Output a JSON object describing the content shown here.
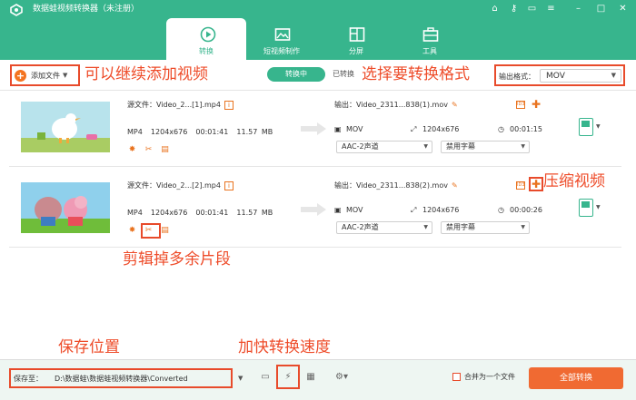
{
  "app": {
    "title": "数据蛙视频转换器（未注册）"
  },
  "window_controls": [
    "cart-icon",
    "key-icon",
    "chat-icon",
    "menu-icon",
    "minimize-icon",
    "maximize-icon",
    "close-icon"
  ],
  "tabs": [
    {
      "label": "转换",
      "icon": "convert-icon",
      "active": true
    },
    {
      "label": "短视频制作",
      "icon": "image-icon",
      "active": false
    },
    {
      "label": "分屏",
      "icon": "split-screen-icon",
      "active": false
    },
    {
      "label": "工具",
      "icon": "toolbox-icon",
      "active": false
    }
  ],
  "toolbar": {
    "add_file_label": "添加文件",
    "converting_label": "转换中",
    "converted_label": "已转换",
    "output_format_label": "输出格式：",
    "output_format_value": "MOV"
  },
  "annotations": {
    "add_more": "可以继续添加视频",
    "choose_format": "选择要转换格式",
    "compress": "压缩视频",
    "trim": "剪辑掉多余片段",
    "save_location": "保存位置",
    "speed_up": "加快转换速度"
  },
  "files": [
    {
      "source_name": "源文件：Video_2...[1].mp4",
      "format": "MP4",
      "resolution": "1204x676",
      "duration": "00:01:41",
      "size": "11.57 MB",
      "output_name": "输出：Video_2311...838(1).mov",
      "out_format": "MOV",
      "out_resolution": "1204x676",
      "out_duration": "00:01:15",
      "audio": "AAC-2声道",
      "subtitle": "禁用字幕"
    },
    {
      "source_name": "源文件：Video_2...[2].mp4",
      "format": "MP4",
      "resolution": "1204x676",
      "duration": "00:01:41",
      "size": "11.57 MB",
      "output_name": "输出：Video_2311...838(2).mov",
      "out_format": "MOV",
      "out_resolution": "1204x676",
      "out_duration": "00:00:26",
      "audio": "AAC-2声道",
      "subtitle": "禁用字幕"
    }
  ],
  "bottom": {
    "save_label": "保存至：",
    "save_path": "D:\\数据蛙\\数据蛙视频转换器\\Converted",
    "merge_label": "合并为一个文件",
    "convert_all_label": "全部转换"
  },
  "colors": {
    "brand": "#37b58d",
    "accent": "#f06a32",
    "annotation": "#ee4c2a"
  }
}
